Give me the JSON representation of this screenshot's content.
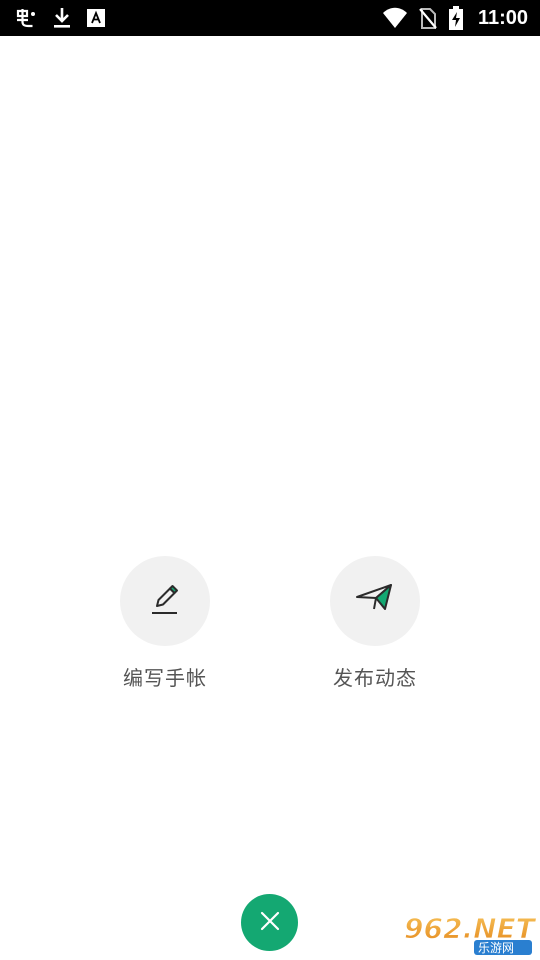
{
  "status_bar": {
    "time": "11:00",
    "left_icons": [
      "app-icon",
      "download-icon",
      "text-a-icon"
    ],
    "right_icons": [
      "wifi-icon",
      "no-sim-icon",
      "battery-charging-icon"
    ]
  },
  "actions": [
    {
      "label": "编写手帐",
      "icon": "pencil-icon"
    },
    {
      "label": "发布动态",
      "icon": "paper-plane-icon"
    }
  ],
  "close_button": {
    "icon": "close-icon"
  },
  "watermark": {
    "brand": "962.NET",
    "subtitle": "乐游网"
  },
  "colors": {
    "accent": "#14a872",
    "circle_bg": "#f1f1f1",
    "label_text": "#555555",
    "status_bar_bg": "#000000"
  }
}
